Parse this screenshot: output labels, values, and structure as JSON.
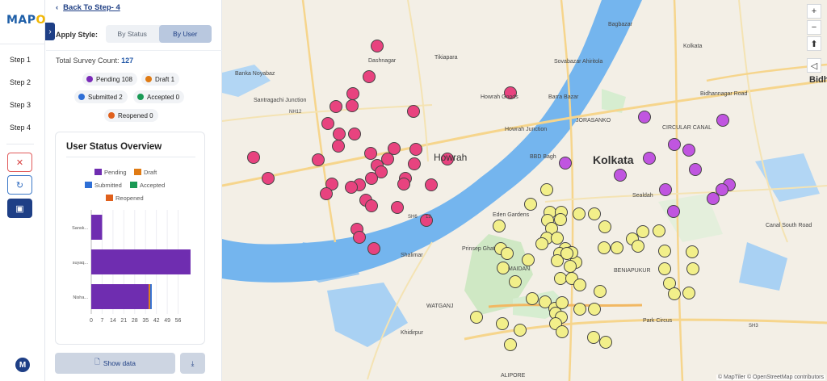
{
  "logo": {
    "text_a": "MAP",
    "text_b": "OG"
  },
  "steps": [
    "Step 1",
    "Step 2",
    "Step 3",
    "Step 4"
  ],
  "rail_icons": {
    "close": "✕",
    "refresh": "↻",
    "box": "▣"
  },
  "avatar": "M",
  "back": {
    "label": "Back To Step- 4"
  },
  "apply_style": {
    "label": "Apply Style:",
    "options": [
      "By Status",
      "By User"
    ],
    "selected": "By User"
  },
  "survey": {
    "label": "Total Survey Count:",
    "count": "127"
  },
  "statuses": [
    {
      "label": "Pending",
      "count": "108",
      "color": "#7a2ab8"
    },
    {
      "label": "Draft",
      "count": "1",
      "color": "#e07b14"
    },
    {
      "label": "Submitted",
      "count": "2",
      "color": "#2f6fd6"
    },
    {
      "label": "Accepted",
      "count": "0",
      "color": "#1a9a55"
    },
    {
      "label": "Reopened",
      "count": "0",
      "color": "#e0601c"
    }
  ],
  "buttons": {
    "show_data": "Show data",
    "download": "⤓"
  },
  "map": {
    "places": {
      "howrah": "Howrah",
      "kolkata": "Kolkata",
      "dashnagar": "Dashnagar",
      "tikiapara": "Tikiapara",
      "howrah_gooo": "Howrah Goods",
      "howrah_junction": "Howrah Junction",
      "jorasanko": "JORASANKO",
      "bbd_bagh": "BBD Bagh",
      "sealdah": "Sealdah",
      "circular_canal": "CIRCULAR CANAL",
      "bidhannagar_road": "Bidhannagar Road",
      "maidan": "MAIDAN",
      "beniapukur": "BENIAPUKUR",
      "watganj": "WATGANJ",
      "khidirpur": "Khidirpur",
      "alipore": "ALIPORE",
      "park_circus": "Park Circus",
      "shalimar": "Shalimar",
      "eden_gardens": "Eden Gardens",
      "bagbazar": "Bagbazar",
      "kolkata_top": "Kolkata",
      "sovabazar": "Sovabazar Ahiritola",
      "barra_bazar": "Barra Bazar",
      "santragachi": "Santragachi Junction",
      "banka": "Banka Noyabaz",
      "canal_south": "Canal South Road",
      "bidh": "Bidh",
      "prinsep": "Prinsep Ghat",
      "nh12": "NH12",
      "sh6": "SH6",
      "sh3": "SH3",
      "num12": "12"
    },
    "controls": {
      "zoom_in": "+",
      "zoom_out": "−",
      "compass": "⬆",
      "locate": "◁"
    },
    "attribution": "© MapTiler © OpenStreetMap contributors"
  },
  "chart_data": {
    "type": "bar",
    "orientation": "horizontal",
    "stacked": true,
    "title": "User Status Overview",
    "categories": [
      "Sansk...",
      "suyaq...",
      "Nisha..."
    ],
    "series": [
      {
        "name": "Pending",
        "color": "#6f2db0",
        "values": [
          7,
          64,
          37
        ]
      },
      {
        "name": "Draft",
        "color": "#e07b14",
        "values": [
          0,
          0,
          1
        ]
      },
      {
        "name": "Submitted",
        "color": "#2f6fd6",
        "values": [
          0,
          0,
          1
        ]
      },
      {
        "name": "Accepted",
        "color": "#1a9a55",
        "values": [
          0,
          0,
          0
        ]
      },
      {
        "name": "Reopened",
        "color": "#e0601c",
        "values": [
          0,
          0,
          0
        ]
      }
    ],
    "xticks": [
      "0",
      "7",
      "14",
      "21",
      "28",
      "35",
      "42",
      "49",
      "56"
    ],
    "xlim": [
      0,
      63
    ],
    "legend": "top",
    "grid": true
  },
  "markers": {
    "pink": {
      "color": "#e8437f"
    },
    "purple": {
      "color": "#c055e0"
    },
    "yellow": {
      "color": "#f2ef8a"
    }
  }
}
